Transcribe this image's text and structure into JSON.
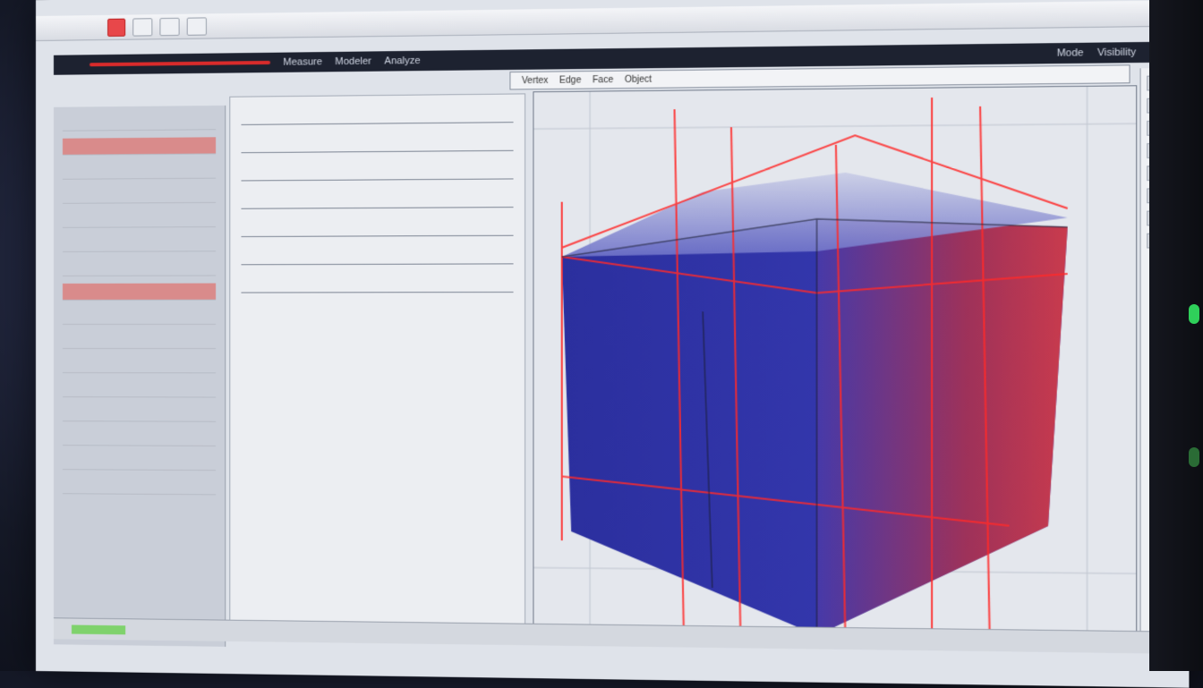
{
  "window": {
    "tabs": [
      "",
      "",
      ""
    ]
  },
  "toolbar": {
    "items": [
      "Measure",
      "Modeler",
      "Analyze"
    ],
    "right_items": [
      "Mode",
      "Visibility"
    ]
  },
  "subbar": {
    "items": [
      "Vertex",
      "Edge",
      "Face",
      "Object"
    ]
  },
  "left_panel": {
    "rows": [
      "",
      "",
      "",
      "",
      "",
      "",
      "",
      "",
      "",
      "",
      "",
      "",
      "",
      "",
      "",
      ""
    ]
  },
  "mid_panel": {
    "fields": [
      "",
      "",
      "",
      "",
      "",
      "",
      ""
    ]
  },
  "colors": {
    "accent": "#d92b2b",
    "model_fill": "#2a2f9c",
    "status_green": "#2fd05a"
  },
  "icons": [
    "close-icon",
    "minimize-icon",
    "maximize-icon"
  ]
}
